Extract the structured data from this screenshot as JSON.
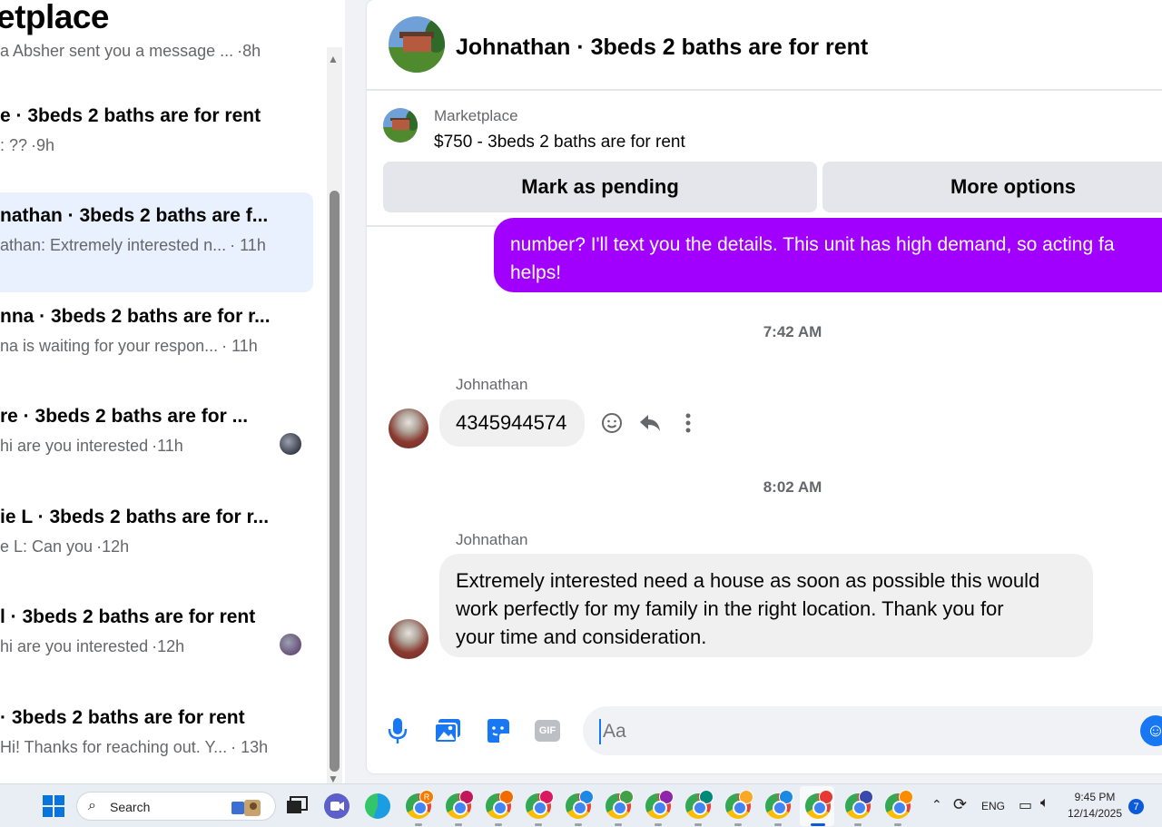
{
  "sidebar": {
    "title": "etplace",
    "conversations": [
      {
        "title": "",
        "snippet": "a Absher sent you a message ...",
        "time": "·8h",
        "active": false,
        "dot": null
      },
      {
        "title": "e · 3beds 2 baths are for rent",
        "snippet": ": ??",
        "time": "·9h",
        "active": false,
        "dot": null
      },
      {
        "title": "nathan · 3beds 2 baths are f...",
        "snippet": "athan: Extremely interested n...",
        "time": "· 11h",
        "active": true,
        "dot": null
      },
      {
        "title": "nna · 3beds 2 baths are for r...",
        "snippet": "na is waiting for your respon...",
        "time": "· 11h",
        "active": false,
        "dot": null
      },
      {
        "title": "re · 3beds 2 baths are for ...",
        "snippet": "hi are you interested",
        "time": "·11h",
        "active": false,
        "dot": "#3a3d4a"
      },
      {
        "title": "ie L · 3beds 2 baths are for r...",
        "snippet": "e L: Can you",
        "time": "·12h",
        "active": false,
        "dot": null
      },
      {
        "title": "l · 3beds 2 baths are for rent",
        "snippet": "hi are you interested",
        "time": "·12h",
        "active": false,
        "dot": "#6a4f7a"
      },
      {
        "title": "· 3beds 2 baths are for rent",
        "snippet": "Hi! Thanks for reaching out. Y...",
        "time": "· 13h",
        "active": false,
        "dot": null
      }
    ]
  },
  "chat": {
    "title": "Johnathan · 3beds 2 baths are for rent",
    "listing": {
      "label": "Marketplace",
      "price_title": "$750 - 3beds 2 baths are for rent",
      "mark_pending": "Mark as pending",
      "more_options": "More options"
    },
    "sent_message": {
      "line1": "number? I'll text you the details. This unit has high demand, so acting fa",
      "line2": "helps!"
    },
    "timestamp1": "7:42 AM",
    "message1": {
      "sender": "Johnathan",
      "text": "4345944574"
    },
    "timestamp2": "8:02 AM",
    "message2": {
      "sender": "Johnathan",
      "line1": "Extremely interested need a house as soon as possible this would",
      "line2": "work perfectly for my family in the right location. Thank you for",
      "line3": "your time and consideration."
    },
    "composer": {
      "placeholder": "Aa",
      "gif_label": "GIF"
    }
  },
  "taskbar": {
    "search_label": "Search",
    "language": "ENG",
    "time": "9:45 PM",
    "date": "12/14/2025",
    "notification_count": "7",
    "first_profile_letter": "R"
  },
  "colors": {
    "accent": "#1877f2",
    "sent_bubble": "#a100ff",
    "active_conversation": "#e8f1fd"
  }
}
